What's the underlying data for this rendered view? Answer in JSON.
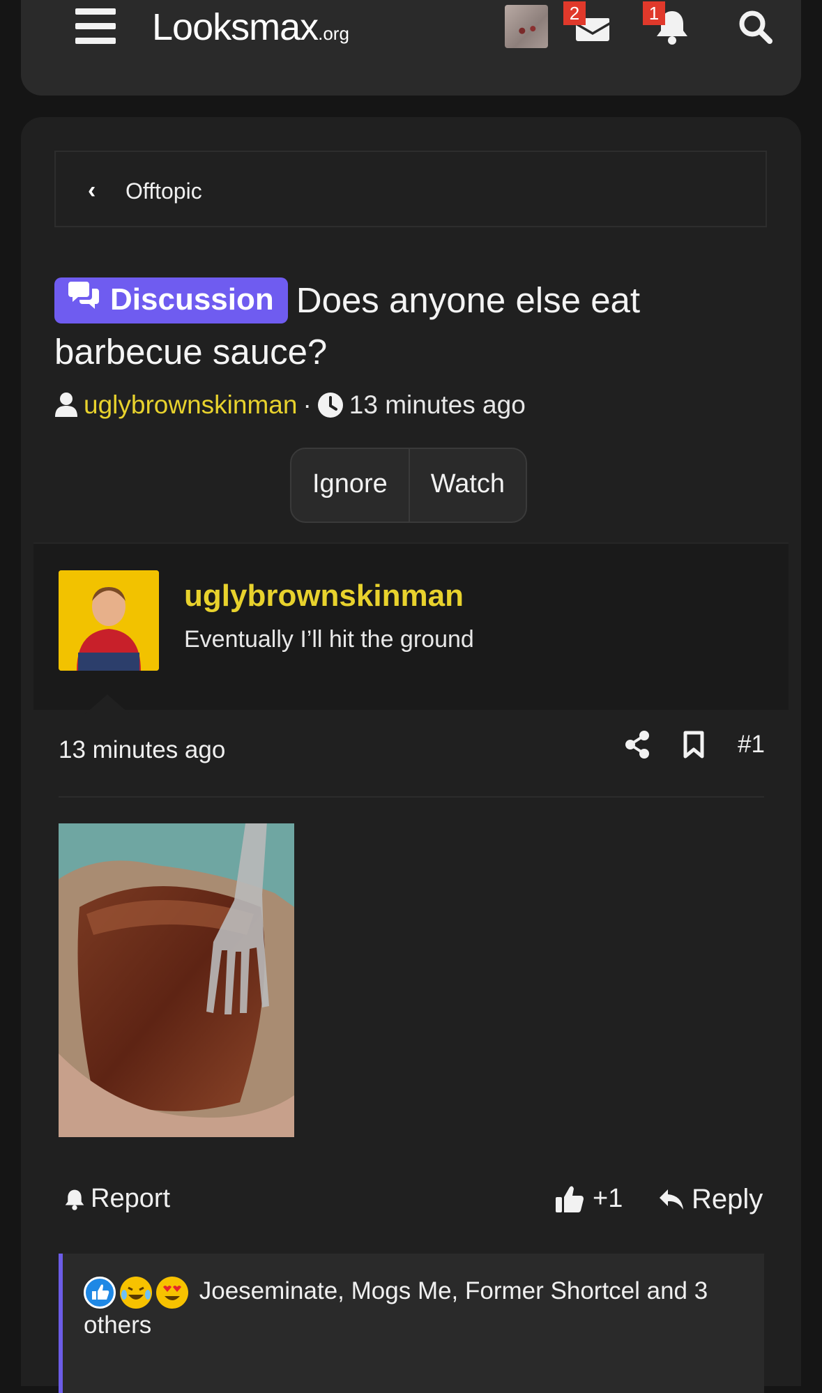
{
  "header": {
    "logo_main": "Looksmax",
    "logo_suffix": ".org",
    "messages_badge": "2",
    "alerts_badge": "1"
  },
  "breadcrumb": {
    "label": "Offtopic"
  },
  "thread": {
    "prefix_label": "Discussion",
    "title": "Does anyone else eat barbecue sauce?",
    "author": "uglybrownskinman",
    "separator": "·",
    "time": "13 minutes ago",
    "ignore_label": "Ignore",
    "watch_label": "Watch"
  },
  "post": {
    "username": "uglybrownskinman",
    "user_title": "Eventually I’ll hit the ground",
    "time": "13 minutes ago",
    "number": "#1",
    "report_label": "Report",
    "plus_label": "+1",
    "reply_label": "Reply",
    "reactions_text": "Joeseminate, Mogs Me, Former Shortcel and 3 others"
  },
  "colors": {
    "accent_yellow": "#e8d22d",
    "discussion_purple": "#6f5cf0",
    "badge_red": "#e0392b"
  }
}
